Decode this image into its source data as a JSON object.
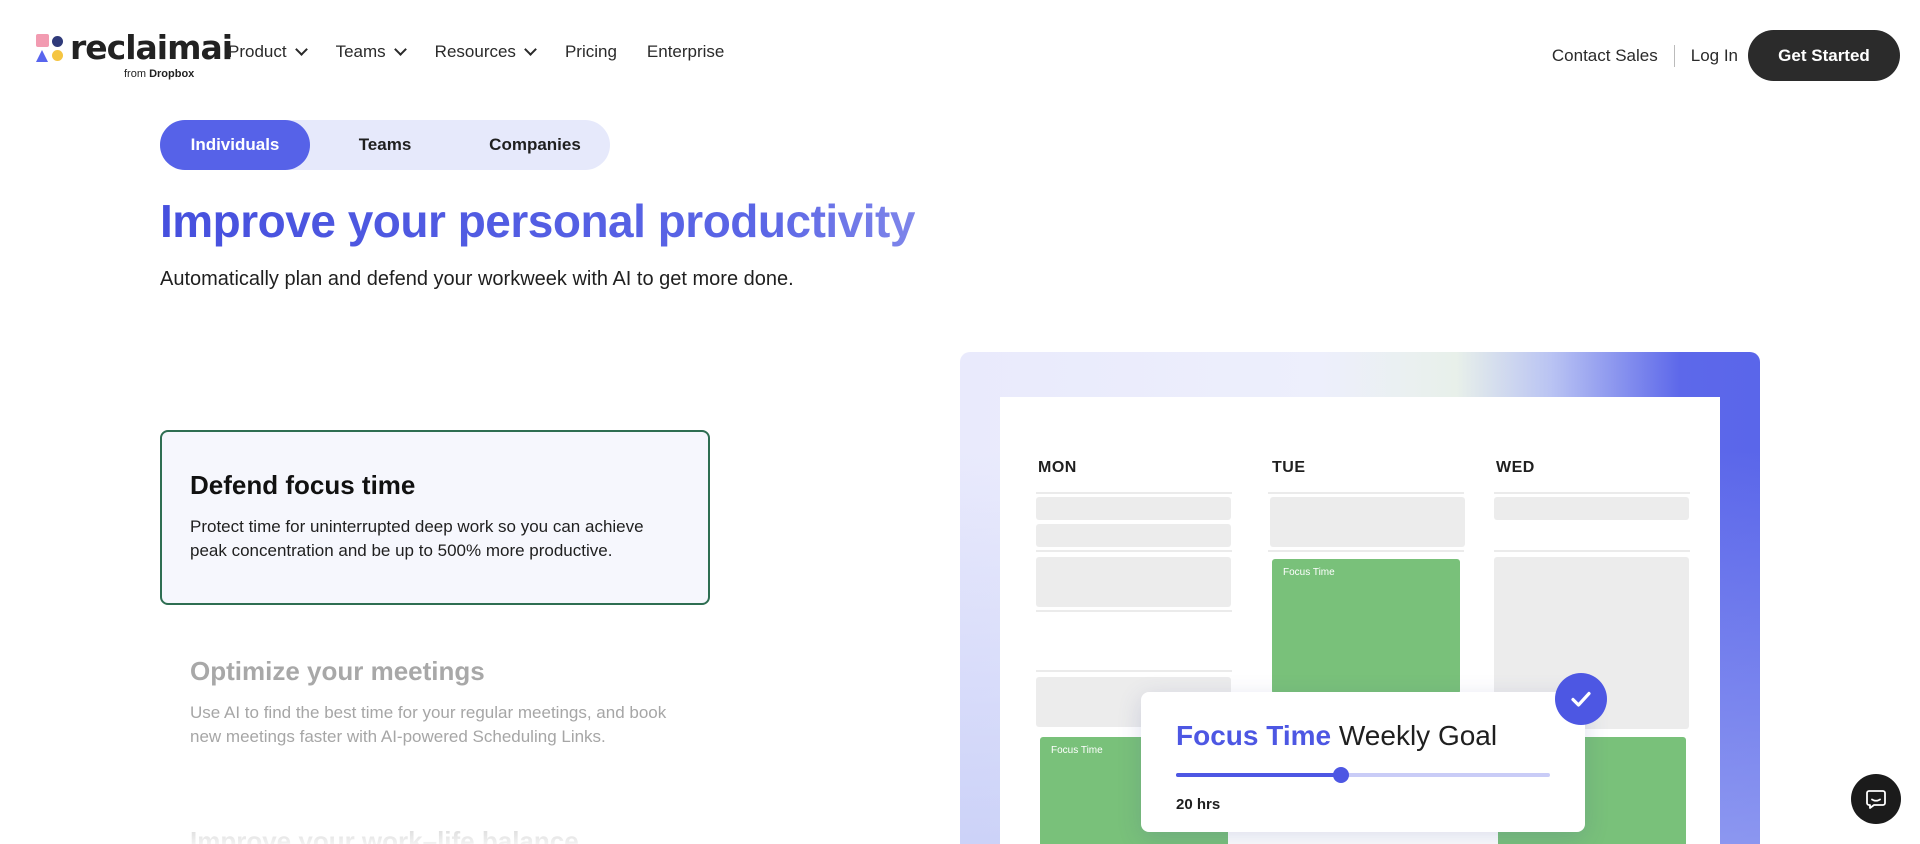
{
  "brand": {
    "name": "reclaimai",
    "sub_prefix": "from",
    "sub_brand": "Dropbox"
  },
  "nav": {
    "items": [
      {
        "label": "Product",
        "dropdown": true
      },
      {
        "label": "Teams",
        "dropdown": true
      },
      {
        "label": "Resources",
        "dropdown": true
      },
      {
        "label": "Pricing",
        "dropdown": false
      },
      {
        "label": "Enterprise",
        "dropdown": false
      }
    ],
    "contact": "Contact Sales",
    "login": "Log In",
    "cta": "Get Started"
  },
  "tabs": [
    {
      "label": "Individuals",
      "active": true
    },
    {
      "label": "Teams",
      "active": false
    },
    {
      "label": "Companies",
      "active": false
    }
  ],
  "hero": {
    "title": "Improve your personal productivity",
    "subtitle": "Automatically plan and defend your workweek with AI to get more done."
  },
  "features": [
    {
      "title": "Defend focus time",
      "text": "Protect time for uninterrupted deep work so you can achieve peak concentration and be up to 500% more productive.",
      "active": true
    },
    {
      "title": "Optimize your meetings",
      "text": "Use AI to find the best time for your regular meetings, and book new meetings faster with AI-powered Scheduling Links.",
      "active": false
    },
    {
      "title": "Improve your work–life balance",
      "text": "",
      "active": false
    }
  ],
  "calendar": {
    "days": [
      "MON",
      "TUE",
      "WED"
    ],
    "event_label": "Focus Time"
  },
  "goal": {
    "title_accent": "Focus Time",
    "title_rest": "Weekly Goal",
    "value_label": "20 hrs",
    "progress": 0.44
  },
  "colors": {
    "accent": "#4d57e3",
    "focus_green": "#79c17a",
    "cta_bg": "#2b2b2b"
  },
  "icons": {
    "chat": "chat-bubble-icon",
    "check": "checkmark-icon"
  }
}
